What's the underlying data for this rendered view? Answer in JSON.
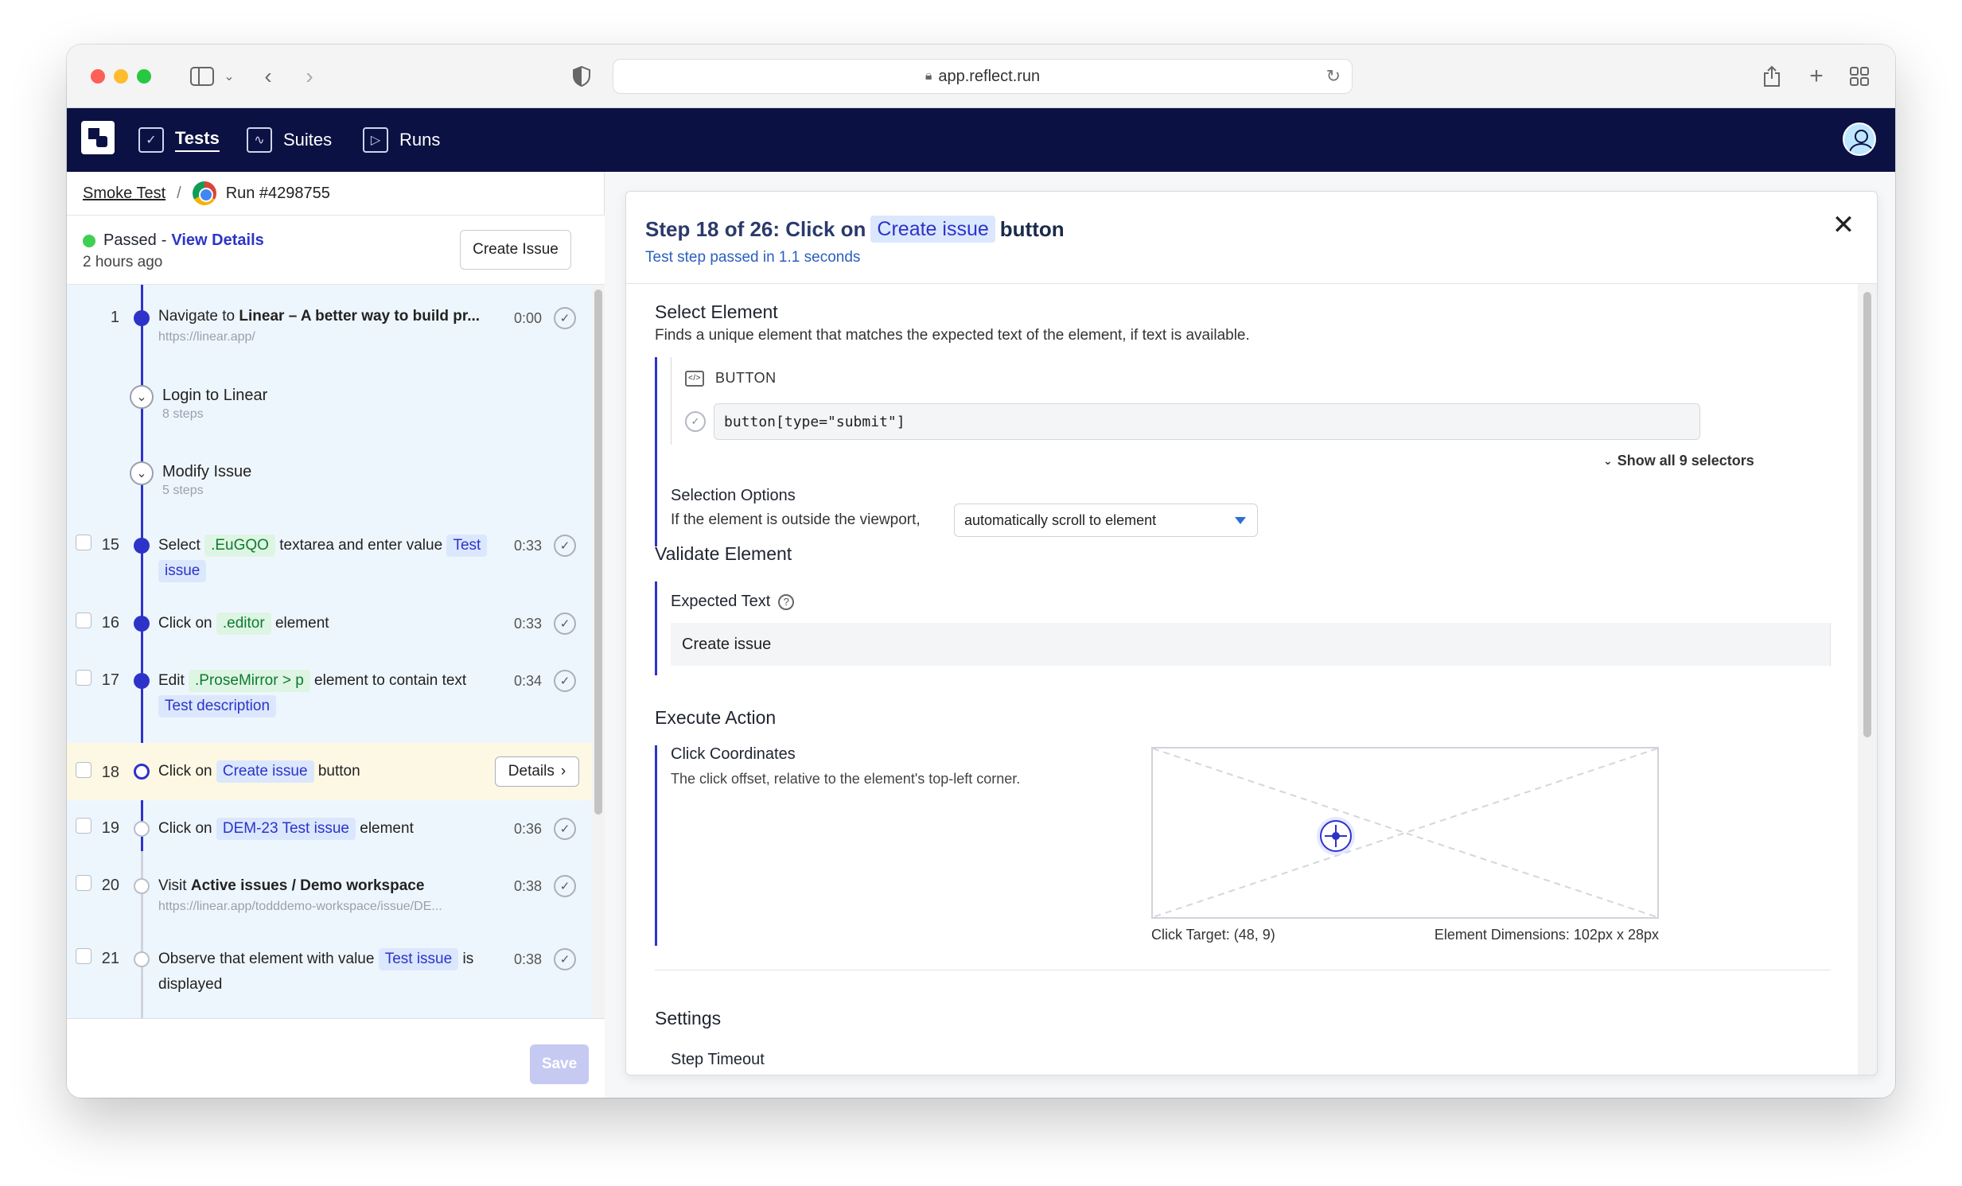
{
  "browser": {
    "url": "app.reflect.run"
  },
  "nav": {
    "items": [
      {
        "label": "Tests",
        "icon": "tests-icon"
      },
      {
        "label": "Suites",
        "icon": "suites-icon"
      },
      {
        "label": "Runs",
        "icon": "runs-icon"
      }
    ]
  },
  "breadcrumb": {
    "test": "Smoke Test",
    "separator": "/",
    "run": "Run #4298755"
  },
  "status": {
    "state": "Passed",
    "dash": "-",
    "view_details": "View Details",
    "time_ago": "2 hours ago",
    "create_issue": "Create Issue"
  },
  "steps": {
    "s1": {
      "num": "1",
      "pre": "Navigate to ",
      "title": "Linear – A better way to build pr...",
      "url": "https://linear.app/",
      "time": "0:00"
    },
    "g1": {
      "title": "Login to Linear",
      "sub": "8 steps"
    },
    "g2": {
      "title": "Modify Issue",
      "sub": "5 steps"
    },
    "s15": {
      "num": "15",
      "a": "Select",
      "chip1": ".EuGQO",
      "b": "textarea and enter value",
      "chip2a": "Test",
      "chip2b": "issue",
      "time": "0:33"
    },
    "s16": {
      "num": "16",
      "a": "Click on",
      "chip1": ".editor",
      "b": "element",
      "time": "0:33"
    },
    "s17": {
      "num": "17",
      "a": "Edit",
      "chip1": ".ProseMirror > p",
      "b": "element to contain text",
      "chip2": "Test description",
      "time": "0:34"
    },
    "s18": {
      "num": "18",
      "a": "Click on",
      "chip1": "Create issue",
      "b": "button",
      "details": "Details"
    },
    "s19": {
      "num": "19",
      "a": "Click on",
      "chip1": "DEM-23 Test issue",
      "b": "element",
      "time": "0:36"
    },
    "s20": {
      "num": "20",
      "pre": "Visit ",
      "title": "Active issues / Demo workspace",
      "url": "https://linear.app/todddemo-workspace/issue/DE...",
      "time": "0:38"
    },
    "s21": {
      "num": "21",
      "a": "Observe that element with value",
      "chip1": "Test issue",
      "b": "is",
      "c": "displayed",
      "time": "0:38"
    }
  },
  "save_label": "Save",
  "modal": {
    "title_prefix": "Step 18 of 26: Click on",
    "title_chip": "Create issue",
    "title_suffix": "button",
    "subtitle": "Test step passed in 1.1 seconds",
    "select_element": {
      "heading": "Select Element",
      "desc": "Finds a unique element that matches the expected text of the element, if text is available.",
      "element_type": "BUTTON",
      "selector": "button[type=\"submit\"]",
      "show_all": "Show all 9 selectors",
      "options_heading": "Selection Options",
      "options_desc": "If the element is outside the viewport,",
      "scroll_option": "automatically scroll to element"
    },
    "validate_element": {
      "heading": "Validate Element",
      "expected_label": "Expected Text",
      "expected_value": "Create issue"
    },
    "execute_action": {
      "heading": "Execute Action",
      "coords_label": "Click Coordinates",
      "coords_desc": "The click offset, relative to the element's top-left corner.",
      "click_target": "Click Target: (48, 9)",
      "dimensions": "Element Dimensions: 102px x 28px"
    },
    "settings": {
      "heading": "Settings",
      "step_timeout": "Step Timeout"
    }
  },
  "colors": {
    "nav_bg": "#0b1142",
    "accent": "#2d33c9",
    "passed": "#3fcf52",
    "selected_row": "#fdf8e4"
  }
}
